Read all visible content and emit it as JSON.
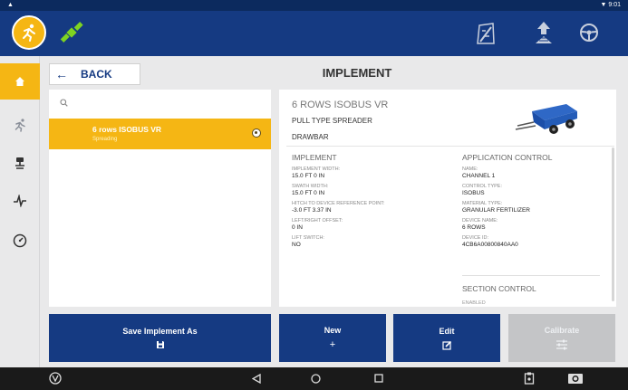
{
  "status_bar": {
    "time": "9:01"
  },
  "header": {
    "logo_icon": "running-person-icon",
    "gps_icon": "satellite-icon",
    "right_icons": [
      "field-boundary-icon",
      "guidance-pivot-icon",
      "steering-wheel-icon"
    ]
  },
  "left_nav": {
    "items": [
      {
        "icon": "home-icon",
        "active": true
      },
      {
        "icon": "running-person-icon",
        "active": false
      },
      {
        "icon": "implement-icon",
        "active": false
      },
      {
        "icon": "pulse-icon",
        "active": false
      },
      {
        "icon": "gauge-icon",
        "active": false
      }
    ]
  },
  "back_button": {
    "label": "BACK"
  },
  "page_title": "IMPLEMENT",
  "implement_list": {
    "search_placeholder": "",
    "items": [
      {
        "name": "6 rows ISOBUS VR",
        "subtitle": "Spreading",
        "selected": true
      }
    ]
  },
  "detail": {
    "name": "6 ROWS ISOBUS VR",
    "type": "PULL TYPE SPREADER",
    "hitch": "DRAWBAR",
    "implement_section": {
      "title": "IMPLEMENT",
      "fields": [
        {
          "key": "IMPLEMENT WIDTH:",
          "value": "15.0 FT 0 IN"
        },
        {
          "key": "SWATH WIDTH:",
          "value": "15.0 FT 0 IN"
        },
        {
          "key": "HITCH TO DEVICE REFERENCE POINT:",
          "value": "-3.0 FT 3.37 IN"
        },
        {
          "key": "LEFT/RIGHT OFFSET:",
          "value": "0 IN"
        },
        {
          "key": "LIFT SWITCH:",
          "value": "NO"
        }
      ]
    },
    "application_section": {
      "title": "APPLICATION CONTROL",
      "fields": [
        {
          "key": "NAME:",
          "value": "CHANNEL 1"
        },
        {
          "key": "CONTROL TYPE:",
          "value": "ISOBUS"
        },
        {
          "key": "MATERIAL TYPE:",
          "value": "GRANULAR FERTILIZER"
        },
        {
          "key": "DEVICE NAME:",
          "value": "6 ROWS"
        },
        {
          "key": "DEVICE ID:",
          "value": "4CB6A00800840AA0"
        }
      ]
    },
    "section_control": {
      "title": "SECTION CONTROL",
      "enabled_label": "ENABLED"
    }
  },
  "actions": {
    "save_as": {
      "label": "Save Implement As",
      "icon": "floppy-disk-icon"
    },
    "new": {
      "label": "New",
      "icon": "plus-icon"
    },
    "edit": {
      "label": "Edit",
      "icon": "edit-icon"
    },
    "calibrate": {
      "label": "Calibrate",
      "icon": "sliders-icon",
      "disabled": true
    }
  },
  "colors": {
    "header_blue": "#153a82",
    "accent_yellow": "#f5b614",
    "disabled_gray": "#c4c5c7"
  }
}
